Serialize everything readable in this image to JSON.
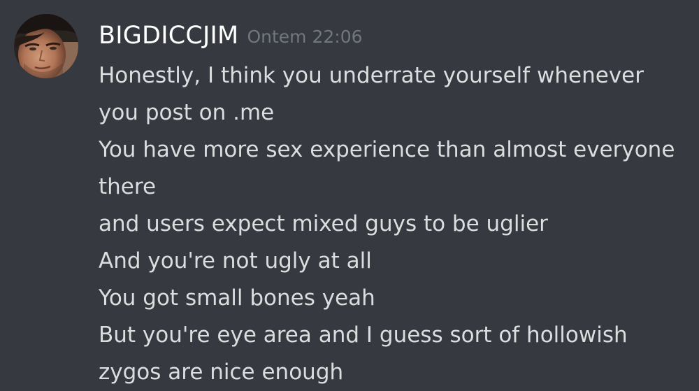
{
  "message": {
    "author": "BIGDICCJIM",
    "timestamp": "Ontem 22:06",
    "avatar_icon": "user-avatar",
    "lines": [
      "Honestly, I think you underrate yourself whenever",
      "you post on .me",
      "You have more sex experience than almost everyone",
      "there",
      "and users expect mixed guys to be uglier",
      "And you're not ugly at all",
      "You got small bones yeah",
      "But you're eye area and I guess sort of hollowish",
      "zygos are nice enough"
    ]
  },
  "colors": {
    "background": "#36393f",
    "username": "#ffffff",
    "timestamp": "#72767d",
    "message_text": "#dcddde"
  }
}
